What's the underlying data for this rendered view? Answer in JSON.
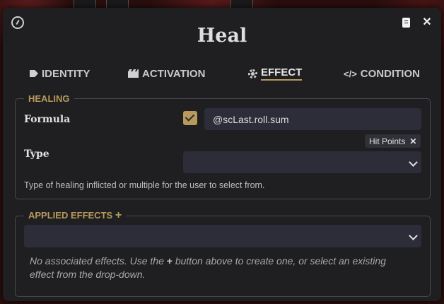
{
  "window": {
    "title": "Heal"
  },
  "header": {
    "left_icon": "dashboard-gauge-icon",
    "doc_icon": "document-icon",
    "close_icon": "close-icon",
    "close_label": "✕"
  },
  "tabs": [
    {
      "label": "IDENTITY",
      "icon": "tag-icon",
      "active": false
    },
    {
      "label": "ACTIVATION",
      "icon": "clapperboard-icon",
      "active": false
    },
    {
      "label": "EFFECT",
      "icon": "gear-icon",
      "active": true
    },
    {
      "label": "CONDITION",
      "icon": "code-icon",
      "active": false
    }
  ],
  "tab_code_glyph": "</>",
  "healing": {
    "legend": "HEALING",
    "formula_label": "Formula",
    "formula_checked": true,
    "formula_value": "@scLast.roll.sum",
    "type_label": "Type",
    "type_tag": "Hit Points",
    "type_tag_remove": "✕",
    "type_value": "",
    "hint": "Type of healing inflicted or multiple for the user to select from."
  },
  "applied_effects": {
    "legend": "APPLIED EFFECTS",
    "add_glyph": "+",
    "select_value": "",
    "hint_before": "No associated effects. Use the",
    "hint_plus": "+",
    "hint_after": "button above to create one, or select an existing effect from the drop-down."
  },
  "colors": {
    "accent": "#b89a5c",
    "panel": "#1f1f21",
    "input": "#2c2d38"
  }
}
